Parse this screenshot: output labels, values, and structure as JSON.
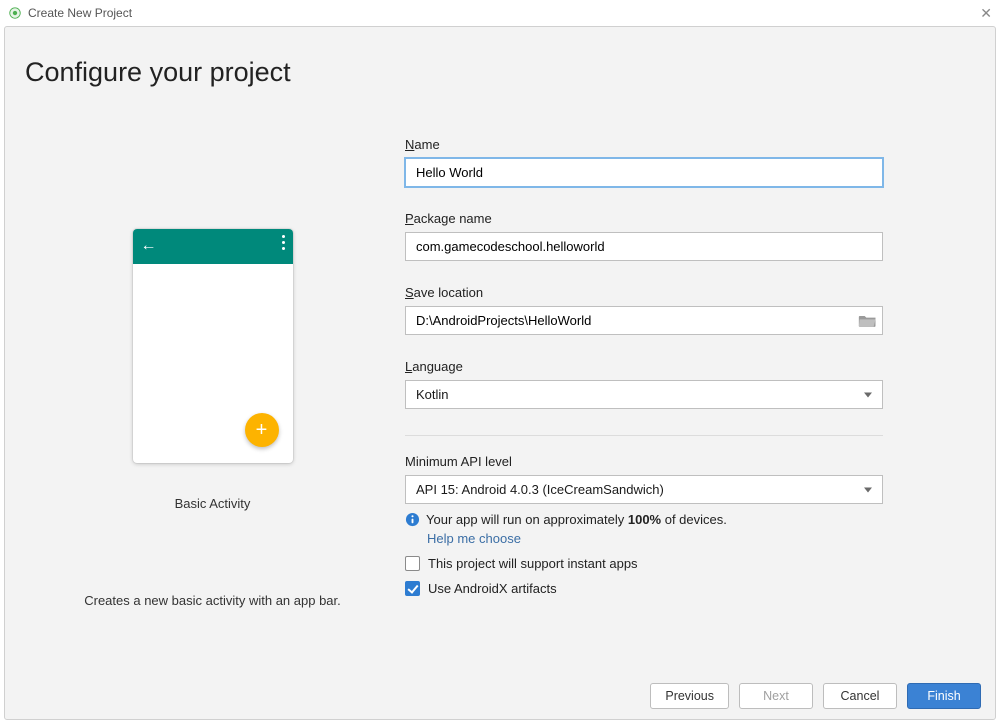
{
  "window": {
    "title": "Create New Project"
  },
  "heading": "Configure your project",
  "preview": {
    "template_name": "Basic Activity",
    "template_desc": "Creates a new basic activity with an app bar."
  },
  "fields": {
    "name_label": "Name",
    "name_value": "Hello World",
    "package_label": "Package name",
    "package_value": "com.gamecodeschool.helloworld",
    "save_label": "Save location",
    "save_value": "D:\\AndroidProjects\\HelloWorld",
    "language_label": "Language",
    "language_value": "Kotlin",
    "api_label": "Minimum API level",
    "api_value": "API 15: Android 4.0.3 (IceCreamSandwich)",
    "api_info_prefix": "Your app will run on approximately ",
    "api_info_pct": "100%",
    "api_info_suffix": " of devices.",
    "help_link": "Help me choose",
    "instant_apps_label": "This project will support instant apps",
    "androidx_label": "Use AndroidX artifacts"
  },
  "buttons": {
    "previous": "Previous",
    "next": "Next",
    "cancel": "Cancel",
    "finish": "Finish"
  },
  "checks": {
    "instant_apps": false,
    "androidx": true
  },
  "colors": {
    "appbar": "#00897b",
    "fab": "#fdb300",
    "primary_button": "#3b82d4",
    "input_focus": "#7fb7e8"
  }
}
